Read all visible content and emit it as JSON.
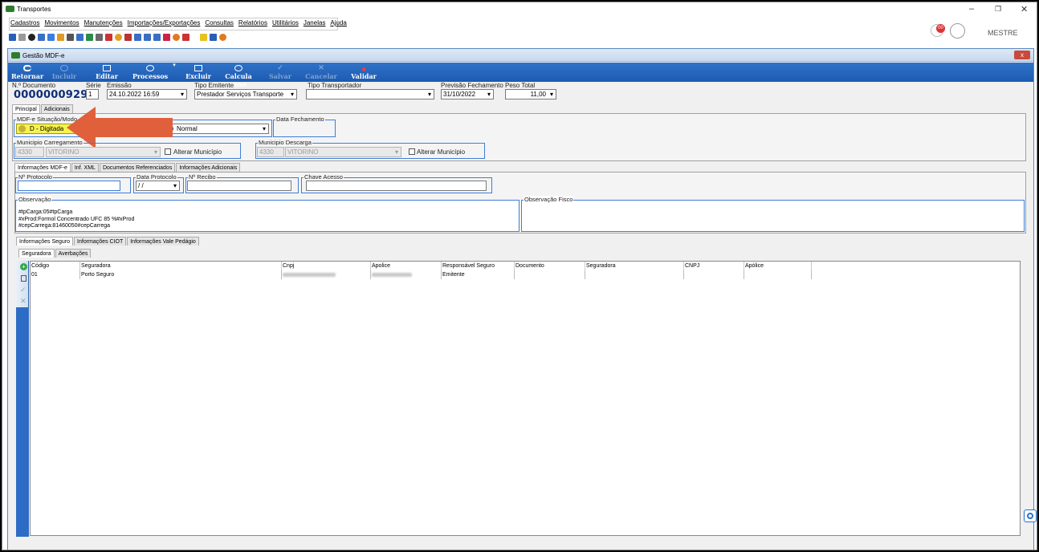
{
  "app": {
    "title": "Transportes",
    "user": "MESTRE",
    "notifications_badge": "00",
    "menu": [
      "Cadastros",
      "Movimentos",
      "Manutenções",
      "Importações/Exportações",
      "Consultas",
      "Relatórios",
      "Utilitários",
      "Janelas",
      "Ajuda"
    ]
  },
  "window": {
    "title": "Gestão MDF-e",
    "close_label": "x"
  },
  "ribbon": {
    "retornar": "Retornar",
    "incluir": "Incluir",
    "editar": "Editar",
    "processos": "Processos",
    "excluir": "Excluir",
    "calcula_peso": "Calcula Peso",
    "salvar": "Salvar",
    "cancelar": "Cancelar",
    "validar": "Validar"
  },
  "header": {
    "doc_label": "N.º Documento",
    "doc_value": "0000000929",
    "serie_label": "Série",
    "serie_value": "1",
    "emissao_label": "Emissão",
    "emissao_value": "24.10.2022 16:59",
    "tipo_emitente_label": "Tipo Emitente",
    "tipo_emitente_value": "Prestador Serviços Transporte",
    "tipo_transportador_label": "Tipo Transportador",
    "tipo_transportador_value": "",
    "previsao_label": "Previsão Fechamento",
    "previsao_value": "31/10/2022",
    "peso_label": "Peso Total",
    "peso_value": "11,00"
  },
  "main_tabs": [
    "Principal",
    "Adicionais"
  ],
  "situacao": {
    "group_label": "MDF-e Situação/Modo",
    "situacao_value": "D - Digitada",
    "modo_value": "Normal",
    "data_fechamento_label": "Data Fechamento"
  },
  "municipio_carregamento": {
    "label": "Municipio Carregamento",
    "code": "4330",
    "name": "VITORINO",
    "alterar_label": "Alterar Município"
  },
  "municipio_descarga": {
    "label": "Municipio Descarga",
    "code": "4330",
    "name": "VITORINO",
    "alterar_label": "Alterar Município"
  },
  "info_tabs": [
    "Informações MDF-e",
    "Inf. XML",
    "Documentos Referenciados",
    "Informações Adicionais"
  ],
  "protocolo": {
    "nprotocolo_label": "Nº Protocolo",
    "nprotocolo_value": "",
    "data_protocolo_label": "Data Protocolo",
    "data_protocolo_value": " / /",
    "nrecibo_label": "Nº Recibo",
    "nrecibo_value": "",
    "chave_label": "Chave Acesso",
    "chave_value": ""
  },
  "observacao": {
    "label": "Observação",
    "lines": [
      "#tpCarga:05#tpCarga",
      "#xProd:Formol Concentrado UFC 85 %#xProd",
      "#cepCarrega:81460050#cepCarrega"
    ],
    "fisco_label": "Observação Fisco"
  },
  "seguro_tabs": [
    "Informações Seguro",
    "Informações CIOT",
    "Informações Vale Pedágio"
  ],
  "sub_tabs": [
    "Seguradora",
    "Averbações"
  ],
  "grid": {
    "headers": [
      "Código",
      "Seguradora",
      "Cnpj",
      "Apolice",
      "Responsável Seguro",
      "Documento",
      "Seguradora",
      "CNPJ",
      "Apólice"
    ],
    "rows": [
      {
        "codigo": "01",
        "seguradora": "Porto Seguro",
        "responsavel": "Emitente"
      }
    ]
  },
  "colors": {
    "ribbon": "#1d5bb0",
    "highlight": "#f6f34d",
    "arrow": "#e0603c",
    "doc_number": "#0d2d7a"
  }
}
